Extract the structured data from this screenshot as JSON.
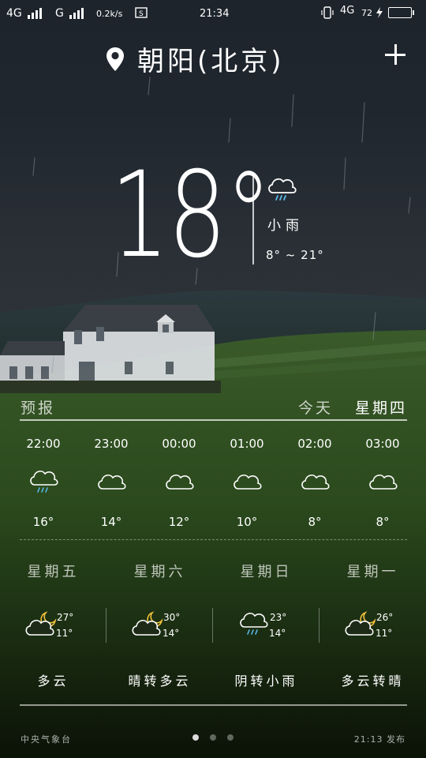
{
  "status_bar": {
    "net1": "4G",
    "net2": "G",
    "speed": "0.2k/s",
    "time": "21:34",
    "net3": "4G",
    "battery_text": "72",
    "battery_level": 0.72,
    "icons": [
      "signal-icon",
      "screenshot-icon",
      "vibrate-icon",
      "charging-icon",
      "battery-icon"
    ]
  },
  "header": {
    "city": "朝阳(北京)",
    "location_icon": "location-pin-icon",
    "add_icon": "plus-icon"
  },
  "current": {
    "temp": "18°",
    "condition": "小雨",
    "range": "8° ~ 21°",
    "icon": "light-rain-icon"
  },
  "forecast_header": {
    "title": "预报",
    "today": "今天",
    "weekday": "星期四"
  },
  "hourly": [
    {
      "time": "22:00",
      "temp": "16°",
      "icon": "light-rain-icon"
    },
    {
      "time": "23:00",
      "temp": "14°",
      "icon": "cloudy-icon"
    },
    {
      "time": "00:00",
      "temp": "12°",
      "icon": "cloudy-icon"
    },
    {
      "time": "01:00",
      "temp": "10°",
      "icon": "cloudy-icon"
    },
    {
      "time": "02:00",
      "temp": "8°",
      "icon": "cloudy-icon"
    },
    {
      "time": "03:00",
      "temp": "8°",
      "icon": "cloudy-icon"
    }
  ],
  "daily": [
    {
      "day": "星期五",
      "high": "27°",
      "low": "11°",
      "desc": "多云",
      "icon": "partly-cloudy-night-icon"
    },
    {
      "day": "星期六",
      "high": "30°",
      "low": "14°",
      "desc": "晴转多云",
      "icon": "partly-cloudy-night-icon"
    },
    {
      "day": "星期日",
      "high": "23°",
      "low": "14°",
      "desc": "阴转小雨",
      "icon": "light-rain-icon"
    },
    {
      "day": "星期一",
      "high": "26°",
      "low": "11°",
      "desc": "多云转晴",
      "icon": "partly-cloudy-night-icon"
    }
  ],
  "footer": {
    "source": "中央气象台",
    "published": "21:13 发布",
    "pages": 3,
    "active_page": 1
  }
}
